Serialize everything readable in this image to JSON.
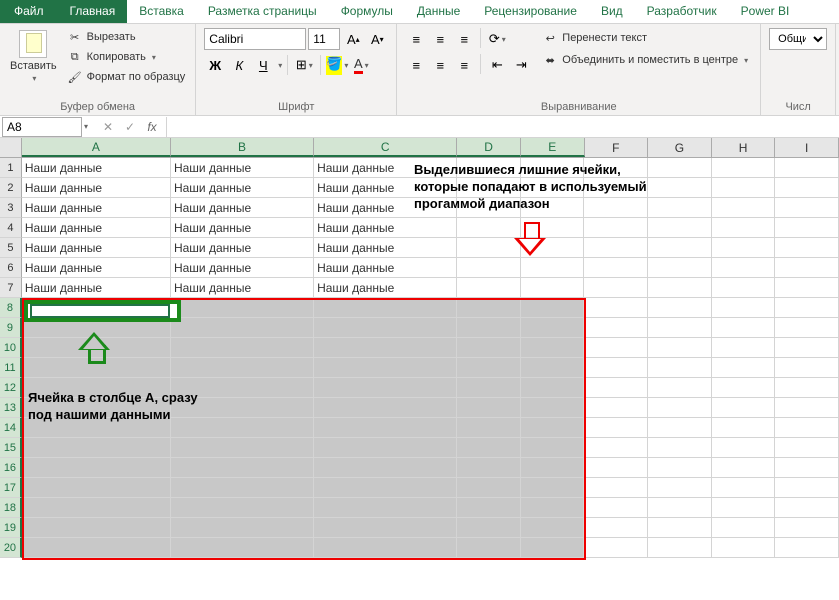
{
  "tabs": {
    "file": "Файл",
    "home": "Главная",
    "insert": "Вставка",
    "layout": "Разметка страницы",
    "formulas": "Формулы",
    "data": "Данные",
    "review": "Рецензирование",
    "view": "Вид",
    "developer": "Разработчик",
    "powerbi": "Power BI"
  },
  "ribbon": {
    "clipboard": {
      "paste": "Вставить",
      "cut": "Вырезать",
      "copy": "Копировать",
      "format_painter": "Формат по образцу",
      "label": "Буфер обмена"
    },
    "font": {
      "name": "Calibri",
      "size": "11",
      "bold": "Ж",
      "italic": "К",
      "underline": "Ч",
      "label": "Шрифт"
    },
    "alignment": {
      "wrap": "Перенести текст",
      "merge": "Объединить и поместить в центре",
      "label": "Выравнивание"
    },
    "number": {
      "format": "Общий",
      "label": "Числ"
    }
  },
  "namebox": "A8",
  "columns": [
    "A",
    "B",
    "C",
    "D",
    "E",
    "F",
    "G",
    "H",
    "I"
  ],
  "rows": [
    "1",
    "2",
    "3",
    "4",
    "5",
    "6",
    "7",
    "8",
    "9",
    "10",
    "11",
    "12",
    "13",
    "14",
    "15",
    "16",
    "17",
    "18",
    "19",
    "20"
  ],
  "cell_text": "Наши данные",
  "annotation1": "Выделившиеся лишние ячейки, которые попадают в используемый прогаммой диапазон",
  "annotation2": "Ячейка в столбце A, сразу под нашими данными"
}
